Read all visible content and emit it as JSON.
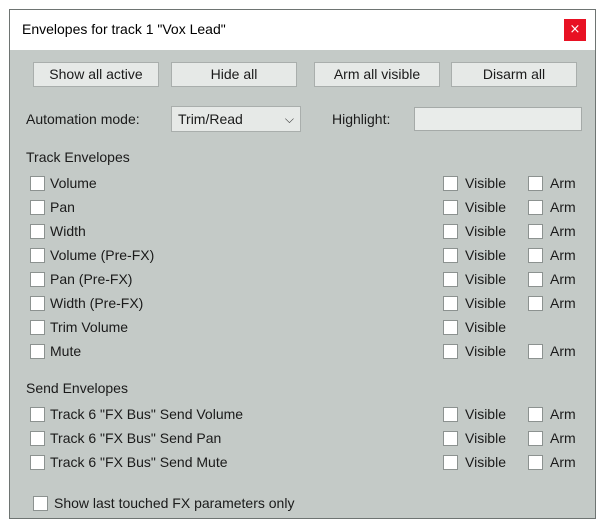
{
  "window": {
    "title": "Envelopes for track 1 \"Vox Lead\"",
    "close_glyph": "×"
  },
  "toolbar": {
    "show_all_active": "Show all active",
    "hide_all": "Hide all",
    "arm_all_visible": "Arm all visible",
    "disarm_all": "Disarm all"
  },
  "automation": {
    "label": "Automation mode:",
    "selected": "Trim/Read",
    "highlight_label": "Highlight:",
    "highlight_value": ""
  },
  "track_envelopes": {
    "heading": "Track Envelopes",
    "items": [
      {
        "label": "Volume",
        "visible_label": "Visible",
        "arm_label": "Arm"
      },
      {
        "label": "Pan",
        "visible_label": "Visible",
        "arm_label": "Arm"
      },
      {
        "label": "Width",
        "visible_label": "Visible",
        "arm_label": "Arm"
      },
      {
        "label": "Volume (Pre-FX)",
        "visible_label": "Visible",
        "arm_label": "Arm"
      },
      {
        "label": "Pan (Pre-FX)",
        "visible_label": "Visible",
        "arm_label": "Arm"
      },
      {
        "label": "Width (Pre-FX)",
        "visible_label": "Visible",
        "arm_label": "Arm"
      },
      {
        "label": "Trim Volume",
        "visible_label": "Visible"
      },
      {
        "label": "Mute",
        "visible_label": "Visible",
        "arm_label": "Arm"
      }
    ]
  },
  "send_envelopes": {
    "heading": "Send Envelopes",
    "items": [
      {
        "label": "Track 6 \"FX Bus\" Send Volume",
        "visible_label": "Visible",
        "arm_label": "Arm"
      },
      {
        "label": "Track 6 \"FX Bus\" Send Pan",
        "visible_label": "Visible",
        "arm_label": "Arm"
      },
      {
        "label": "Track 6 \"FX Bus\" Send Mute",
        "visible_label": "Visible",
        "arm_label": "Arm"
      }
    ]
  },
  "footer": {
    "show_last_touched": "Show last touched FX parameters only"
  }
}
